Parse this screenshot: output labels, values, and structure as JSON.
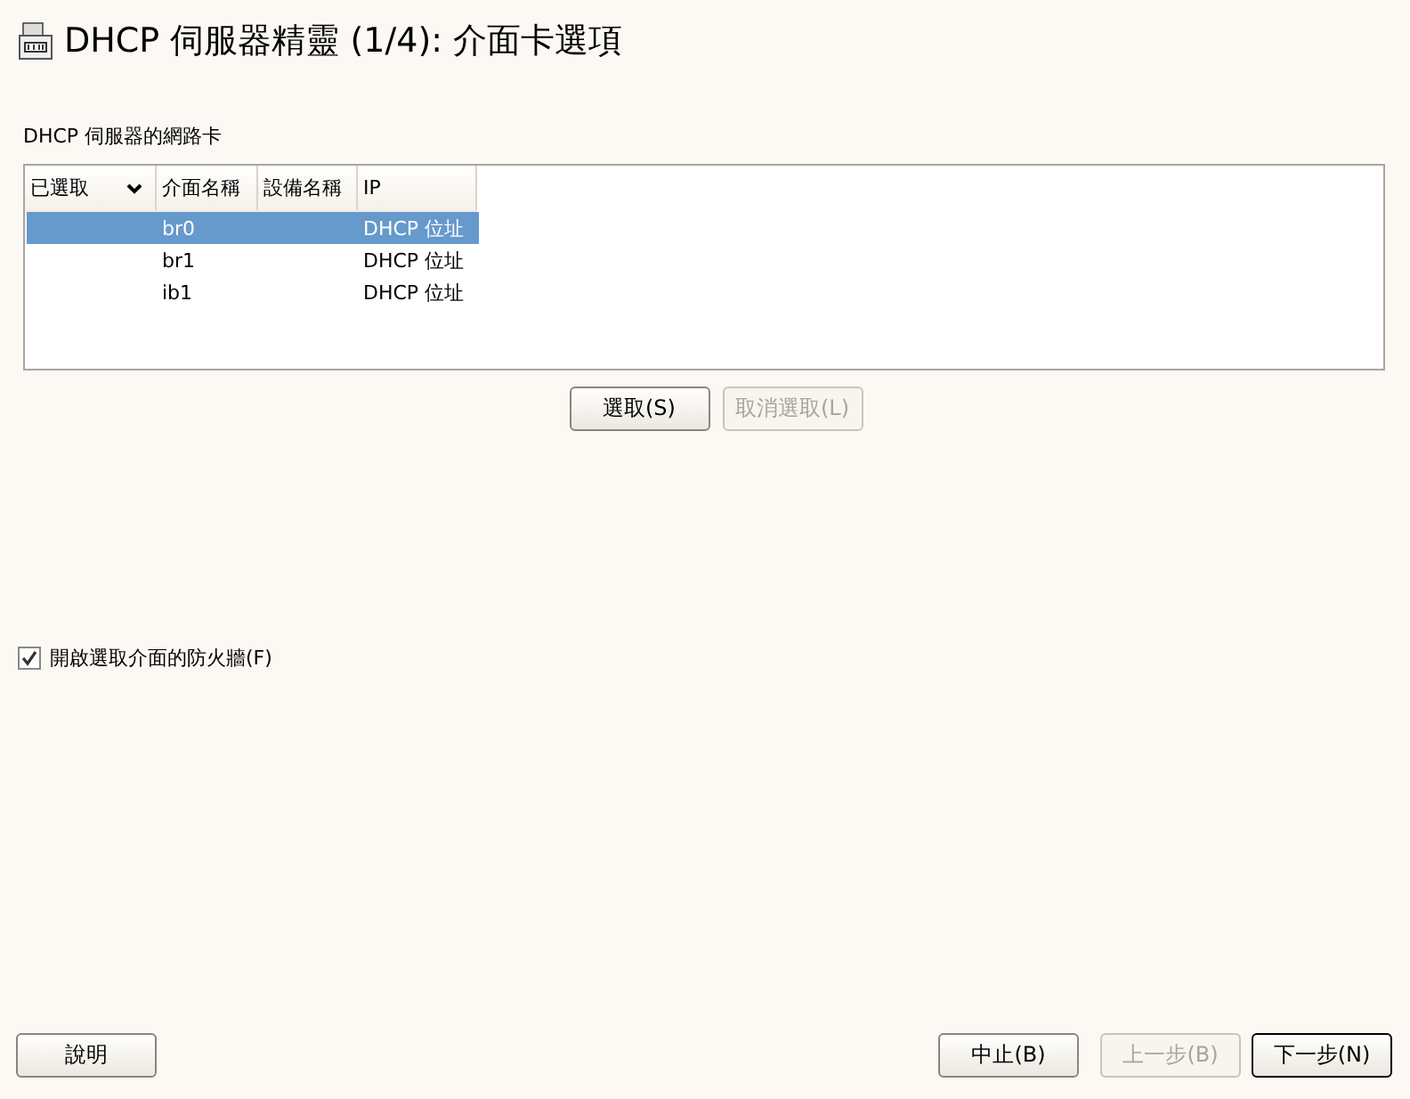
{
  "window": {
    "title": "DHCP 伺服器精靈 (1/4): 介面卡選項"
  },
  "table": {
    "label": "DHCP 伺服器的網路卡",
    "columns": [
      {
        "label": "已選取",
        "sorted": true
      },
      {
        "label": "介面名稱",
        "sorted": false
      },
      {
        "label": "設備名稱",
        "sorted": false
      },
      {
        "label": "IP",
        "sorted": false
      }
    ],
    "rows": [
      {
        "selected": true,
        "cells": [
          "",
          "br0",
          "",
          "DHCP 位址"
        ]
      },
      {
        "selected": false,
        "cells": [
          "",
          "br1",
          "",
          "DHCP 位址"
        ]
      },
      {
        "selected": false,
        "cells": [
          "",
          "ib1",
          "",
          "DHCP 位址"
        ]
      }
    ]
  },
  "table_buttons": [
    {
      "label": "選取(S)",
      "disabled": false
    },
    {
      "label": "取消選取(L)",
      "disabled": true
    }
  ],
  "firewall": {
    "label": "開啟選取介面的防火牆(F)",
    "checked": true
  },
  "footer": {
    "help": {
      "label": "說明",
      "disabled": false
    },
    "buttons": [
      {
        "label": "中止(B)",
        "disabled": false,
        "default": false
      },
      {
        "label": "上一步(B)",
        "disabled": true,
        "default": false
      },
      {
        "label": "下一步(N)",
        "disabled": false,
        "default": true
      }
    ]
  }
}
